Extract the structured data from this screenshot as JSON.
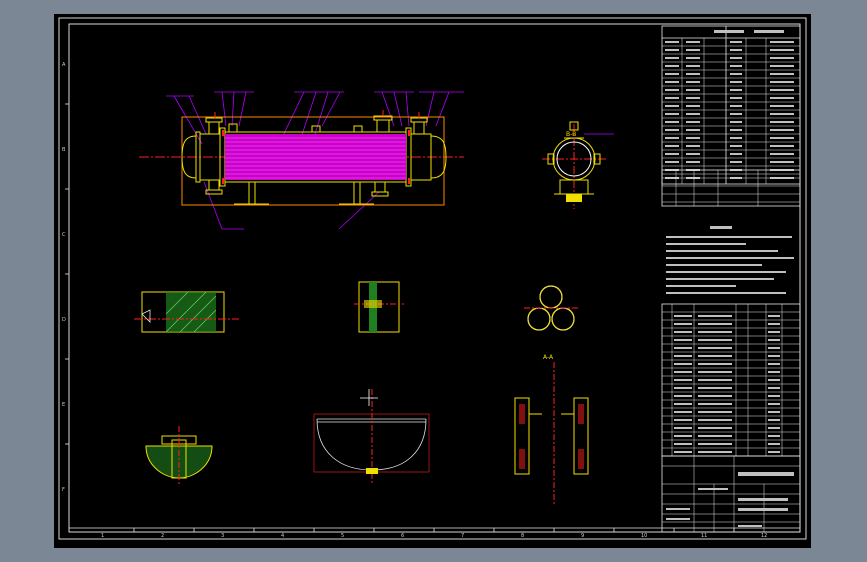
{
  "colors": {
    "canvas": "#000000",
    "frame": "#d8d8d8",
    "shell": "#f0e000",
    "tube_bundle": "#ff00ff",
    "centerline": "#ff2020",
    "leader": "#b000ff",
    "hatch": "#30c030"
  },
  "drawing": {
    "section_b": "B-B",
    "section_a": "A-A",
    "zone_numbers_bottom": [
      "1",
      "2",
      "3",
      "4",
      "5",
      "6",
      "7",
      "8",
      "9",
      "10",
      "11",
      "12"
    ],
    "zone_letters_side": [
      "A",
      "B",
      "C",
      "D",
      "E",
      "F"
    ]
  }
}
